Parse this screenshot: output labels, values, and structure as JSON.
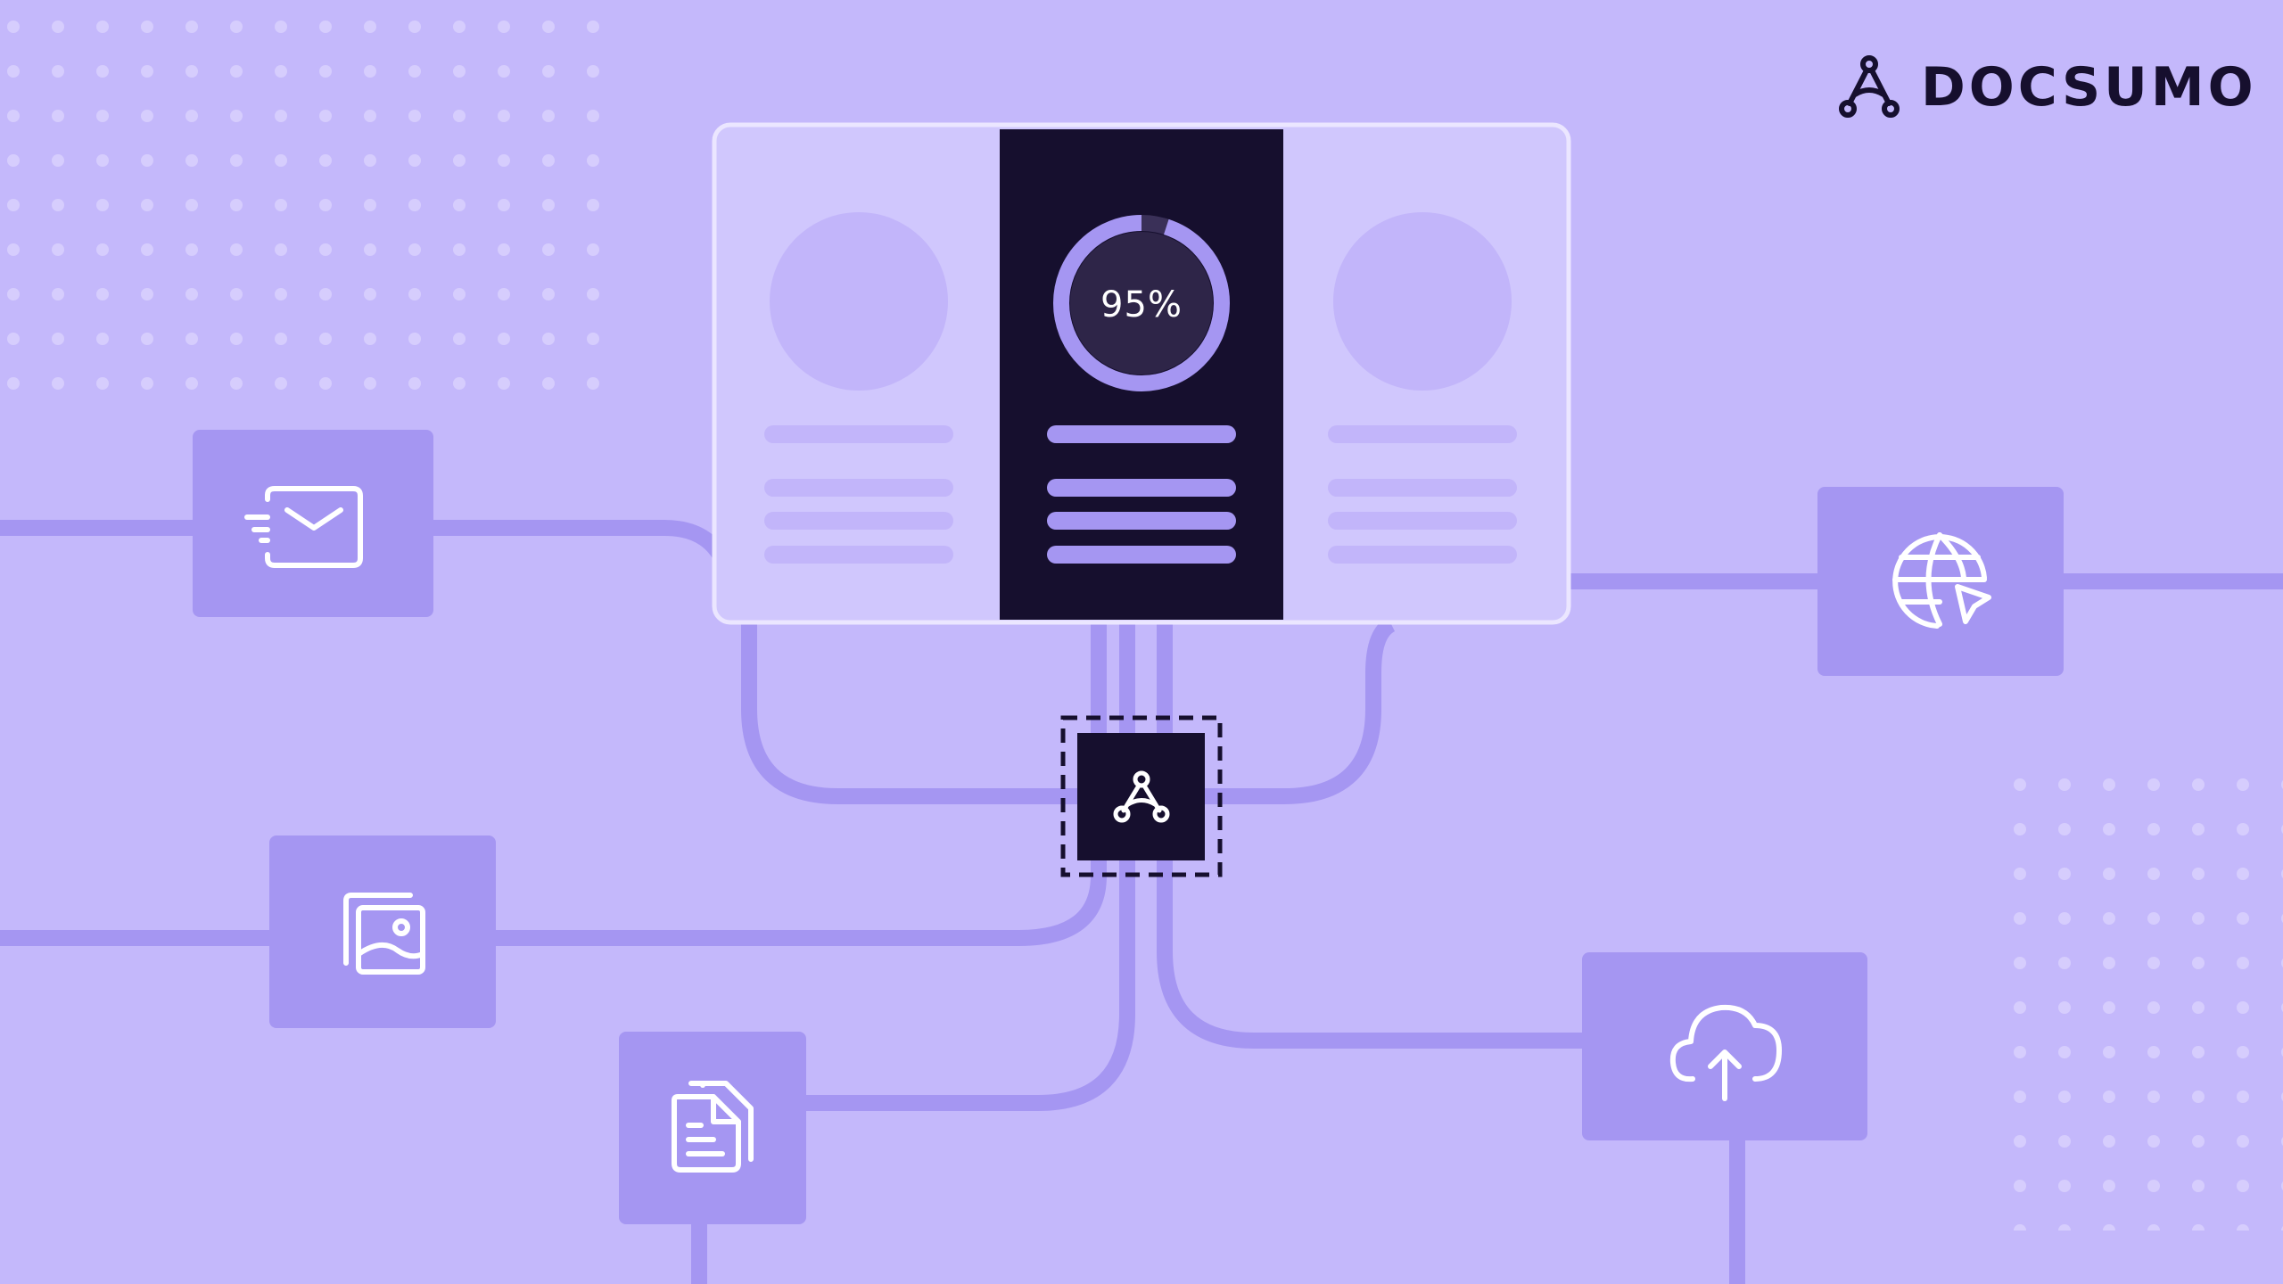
{
  "brand": {
    "name": "DOCSUMO",
    "logo_icon": "docsumo-logo-icon"
  },
  "accuracy_card": {
    "progress_label": "95%",
    "progress_value": 95
  },
  "nodes": [
    {
      "id": "email",
      "icon": "email-send-icon"
    },
    {
      "id": "images",
      "icon": "image-gallery-icon"
    },
    {
      "id": "documents",
      "icon": "document-stack-icon"
    },
    {
      "id": "web",
      "icon": "globe-cursor-icon"
    },
    {
      "id": "cloud",
      "icon": "cloud-upload-icon"
    },
    {
      "id": "hub",
      "icon": "docsumo-hub-icon"
    }
  ],
  "colors": {
    "background": "#c4b8fb",
    "tile": "#a596f2",
    "line": "#a596f2",
    "dark": "#160f2e",
    "panel_light": "#d0c7fd",
    "accent": "#a596f2"
  }
}
